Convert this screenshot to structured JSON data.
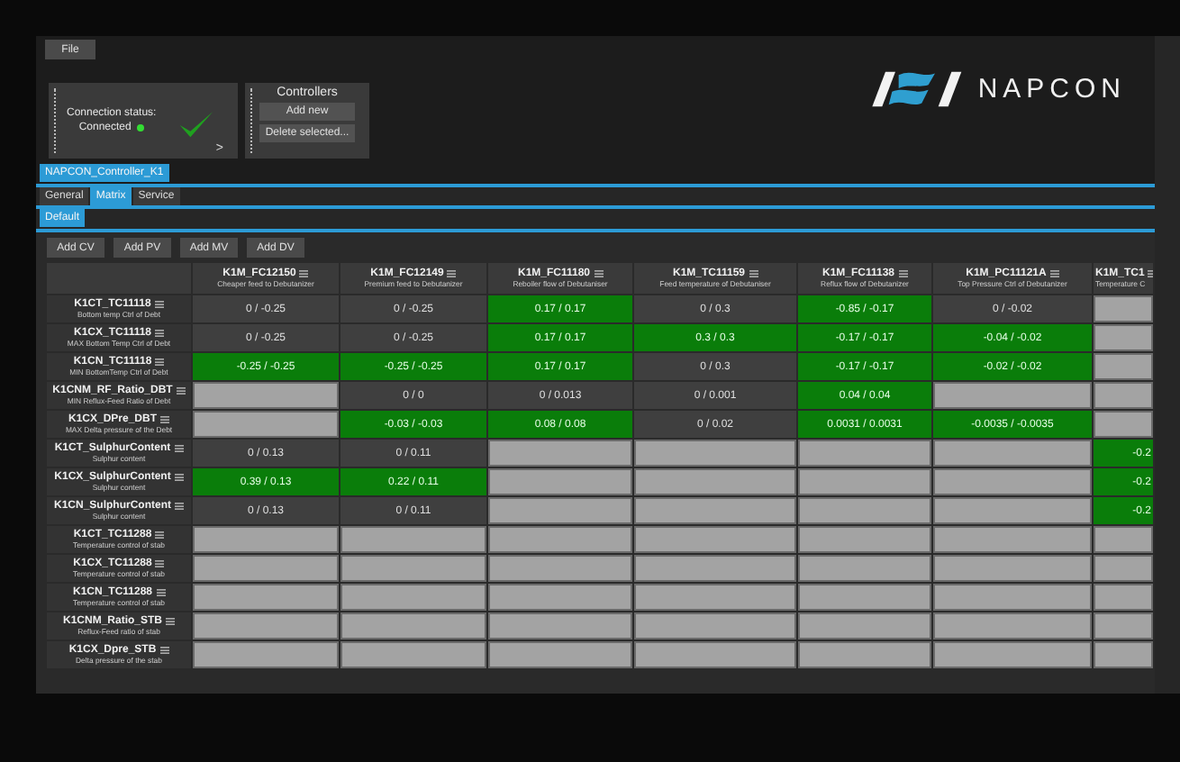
{
  "menu": {
    "file": "File"
  },
  "connection": {
    "label": "Connection status:",
    "status": "Connected",
    "connected": true,
    "expand": ">"
  },
  "controllers": {
    "title": "Controllers",
    "buttons": [
      "Add new",
      "Delete selected..."
    ]
  },
  "logo": {
    "text": "NAPCON"
  },
  "controller_tab": {
    "label": "NAPCON_Controller_K1",
    "selected": true
  },
  "tabs": [
    {
      "label": "General",
      "selected": false
    },
    {
      "label": "Matrix",
      "selected": true
    },
    {
      "label": "Service",
      "selected": false
    }
  ],
  "subtabs": [
    {
      "label": "Default",
      "selected": true
    }
  ],
  "toolbar": [
    "Add CV",
    "Add PV",
    "Add MV",
    "Add DV"
  ],
  "table": {
    "columns": [
      {
        "name": "K1M_FC12150",
        "desc": "Cheaper feed to Debutanizer"
      },
      {
        "name": "K1M_FC12149",
        "desc": "Premium feed to Debutanizer"
      },
      {
        "name": "K1M_FC11180",
        "desc": "Reboiler flow of Debutaniser"
      },
      {
        "name": "K1M_TC11159",
        "desc": "Feed temperature of Debutaniser"
      },
      {
        "name": "K1M_FC11138",
        "desc": "Reflux flow of Debutanizer"
      },
      {
        "name": "K1M_PC11121A",
        "desc": "Top Pressure Ctrl of Debutanizer"
      },
      {
        "name": "K1M_TC1",
        "desc": "Temperature C"
      }
    ],
    "rows": [
      {
        "name": "K1CT_TC11118",
        "desc": "Bottom temp Ctrl of Debt",
        "cells": [
          {
            "kind": "value",
            "text": "0 / -0.25"
          },
          {
            "kind": "value",
            "text": "0 / -0.25"
          },
          {
            "kind": "match",
            "text": "0.17 / 0.17"
          },
          {
            "kind": "value",
            "text": "0 / 0.3"
          },
          {
            "kind": "match",
            "text": "-0.85 / -0.17"
          },
          {
            "kind": "value",
            "text": "0 / -0.02"
          },
          {
            "kind": "blank"
          }
        ]
      },
      {
        "name": "K1CX_TC11118",
        "desc": "MAX Bottom Temp Ctrl of Debt",
        "cells": [
          {
            "kind": "value",
            "text": "0 / -0.25"
          },
          {
            "kind": "value",
            "text": "0 / -0.25"
          },
          {
            "kind": "match",
            "text": "0.17 / 0.17"
          },
          {
            "kind": "match",
            "text": "0.3 / 0.3"
          },
          {
            "kind": "match",
            "text": "-0.17 / -0.17"
          },
          {
            "kind": "match",
            "text": "-0.04 / -0.02"
          },
          {
            "kind": "blank"
          }
        ]
      },
      {
        "name": "K1CN_TC11118",
        "desc": "MIN BottomTemp Ctrl of Debt",
        "cells": [
          {
            "kind": "match",
            "text": "-0.25 / -0.25"
          },
          {
            "kind": "match",
            "text": "-0.25 / -0.25"
          },
          {
            "kind": "match",
            "text": "0.17 / 0.17"
          },
          {
            "kind": "value",
            "text": "0 / 0.3"
          },
          {
            "kind": "match",
            "text": "-0.17 / -0.17"
          },
          {
            "kind": "match",
            "text": "-0.02 / -0.02"
          },
          {
            "kind": "blank"
          }
        ]
      },
      {
        "name": "K1CNM_RF_Ratio_DBT",
        "desc": "MIN Reflux-Feed Ratio of Debt",
        "cells": [
          {
            "kind": "blank"
          },
          {
            "kind": "value",
            "text": "0 / 0"
          },
          {
            "kind": "value",
            "text": "0 / 0.013"
          },
          {
            "kind": "value",
            "text": "0 / 0.001"
          },
          {
            "kind": "match",
            "text": "0.04 / 0.04"
          },
          {
            "kind": "blank"
          },
          {
            "kind": "blank"
          }
        ]
      },
      {
        "name": "K1CX_DPre_DBT",
        "desc": "MAX Delta pressure of the Debt",
        "cells": [
          {
            "kind": "blank"
          },
          {
            "kind": "match",
            "text": "-0.03 / -0.03"
          },
          {
            "kind": "match",
            "text": "0.08 / 0.08"
          },
          {
            "kind": "value",
            "text": "0 / 0.02"
          },
          {
            "kind": "match",
            "text": "0.0031 / 0.0031"
          },
          {
            "kind": "match",
            "text": "-0.0035 / -0.0035"
          },
          {
            "kind": "blank"
          }
        ]
      },
      {
        "name": "K1CT_SulphurContent",
        "desc": "Sulphur content",
        "cells": [
          {
            "kind": "value",
            "text": "0 / 0.13"
          },
          {
            "kind": "value",
            "text": "0 / 0.11"
          },
          {
            "kind": "blank"
          },
          {
            "kind": "blank"
          },
          {
            "kind": "blank"
          },
          {
            "kind": "blank"
          },
          {
            "kind": "match",
            "text": "-0.2"
          }
        ]
      },
      {
        "name": "K1CX_SulphurContent",
        "desc": "Sulphur content",
        "cells": [
          {
            "kind": "match",
            "text": "0.39 / 0.13"
          },
          {
            "kind": "match",
            "text": "0.22 / 0.11"
          },
          {
            "kind": "blank"
          },
          {
            "kind": "blank"
          },
          {
            "kind": "blank"
          },
          {
            "kind": "blank"
          },
          {
            "kind": "match",
            "text": "-0.2"
          }
        ]
      },
      {
        "name": "K1CN_SulphurContent",
        "desc": "Sulphur content",
        "cells": [
          {
            "kind": "value",
            "text": "0 / 0.13"
          },
          {
            "kind": "value",
            "text": "0 / 0.11"
          },
          {
            "kind": "blank"
          },
          {
            "kind": "blank"
          },
          {
            "kind": "blank"
          },
          {
            "kind": "blank"
          },
          {
            "kind": "match",
            "text": "-0.2"
          }
        ]
      },
      {
        "name": "K1CT_TC11288",
        "desc": "Temperature control of stab",
        "cells": [
          {
            "kind": "blank"
          },
          {
            "kind": "blank"
          },
          {
            "kind": "blank"
          },
          {
            "kind": "blank"
          },
          {
            "kind": "blank"
          },
          {
            "kind": "blank"
          },
          {
            "kind": "blank"
          }
        ]
      },
      {
        "name": "K1CX_TC11288",
        "desc": "Temperature control of stab",
        "cells": [
          {
            "kind": "blank"
          },
          {
            "kind": "blank"
          },
          {
            "kind": "blank"
          },
          {
            "kind": "blank"
          },
          {
            "kind": "blank"
          },
          {
            "kind": "blank"
          },
          {
            "kind": "blank"
          }
        ]
      },
      {
        "name": "K1CN_TC11288",
        "desc": "Temperature control of stab",
        "cells": [
          {
            "kind": "blank"
          },
          {
            "kind": "blank"
          },
          {
            "kind": "blank"
          },
          {
            "kind": "blank"
          },
          {
            "kind": "blank"
          },
          {
            "kind": "blank"
          },
          {
            "kind": "blank"
          }
        ]
      },
      {
        "name": "K1CNM_Ratio_STB",
        "desc": "Reflux-Feed ratio of stab",
        "cells": [
          {
            "kind": "blank"
          },
          {
            "kind": "blank"
          },
          {
            "kind": "blank"
          },
          {
            "kind": "blank"
          },
          {
            "kind": "blank"
          },
          {
            "kind": "blank"
          },
          {
            "kind": "blank"
          }
        ]
      },
      {
        "name": "K1CX_Dpre_STB",
        "desc": "Delta pressure of the stab",
        "cells": [
          {
            "kind": "blank"
          },
          {
            "kind": "blank"
          },
          {
            "kind": "blank"
          },
          {
            "kind": "blank"
          },
          {
            "kind": "blank"
          },
          {
            "kind": "blank"
          },
          {
            "kind": "blank"
          }
        ]
      }
    ]
  }
}
